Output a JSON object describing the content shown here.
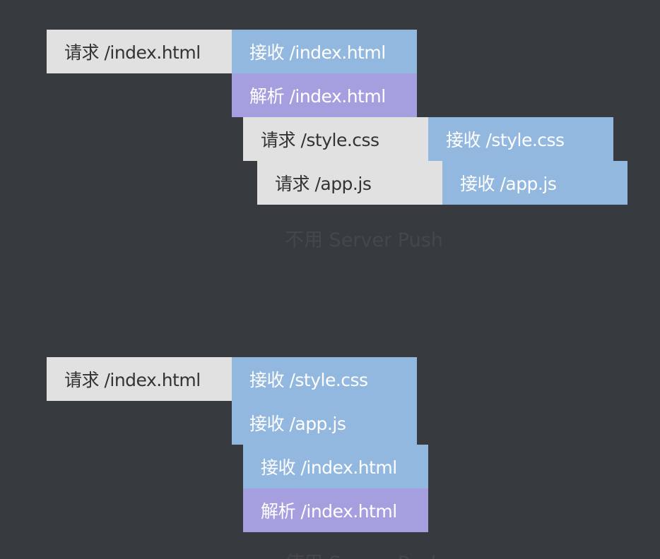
{
  "diagram1": {
    "blocks": [
      {
        "kind": "request",
        "text": "请求 /index.html"
      },
      {
        "kind": "receive",
        "text": "接收 /index.html"
      },
      {
        "kind": "parse",
        "text": "解析 /index.html"
      },
      {
        "kind": "request",
        "text": "请求 /style.css"
      },
      {
        "kind": "receive",
        "text": "接收 /style.css"
      },
      {
        "kind": "request",
        "text": "请求 /app.js"
      },
      {
        "kind": "receive",
        "text": "接收 /app.js"
      }
    ],
    "caption": "不用 Server Push"
  },
  "diagram2": {
    "blocks": [
      {
        "kind": "request",
        "text": "请求 /index.html"
      },
      {
        "kind": "receive",
        "text": "接收 /style.css"
      },
      {
        "kind": "receive",
        "text": "接收 /app.js"
      },
      {
        "kind": "receive",
        "text": "接收 /index.html"
      },
      {
        "kind": "parse",
        "text": "解析 /index.html"
      }
    ],
    "caption": "使用 Server Push"
  },
  "colors": {
    "background": "#373a3f",
    "request": "#e1e1e1",
    "receive": "#93b8e0",
    "parse": "#a59fe0",
    "caption": "#44474c"
  }
}
